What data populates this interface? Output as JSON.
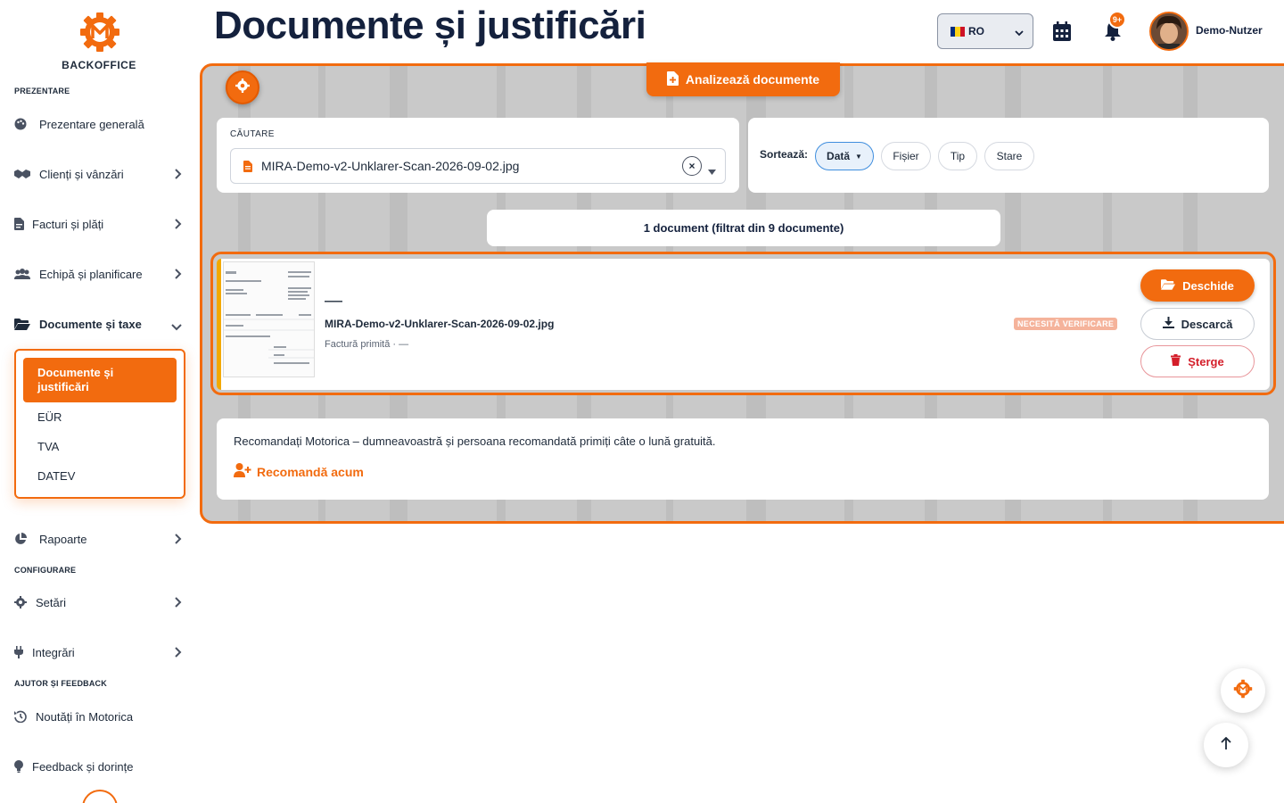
{
  "sidebar": {
    "logo_text": "BACKOFFICE",
    "sections": {
      "prezentare": "PREZENTARE",
      "configurare": "CONFIGURARE",
      "ajutor": "AJUTOR ȘI FEEDBACK"
    },
    "items": [
      {
        "label": "Prezentare generală",
        "icon": "palette-icon"
      },
      {
        "label": "Clienți și vânzări",
        "icon": "handshake-icon"
      },
      {
        "label": "Facturi și plăți",
        "icon": "invoice-icon"
      },
      {
        "label": "Echipă și planificare",
        "icon": "users-icon"
      },
      {
        "label": "Documente și taxe",
        "icon": "folder-open-icon"
      },
      {
        "label": "Rapoarte",
        "icon": "pie-chart-icon"
      },
      {
        "label": "Setări",
        "icon": "gear-icon"
      },
      {
        "label": "Integrări",
        "icon": "plug-icon"
      },
      {
        "label": "Noutăți în Motorica",
        "icon": "history-icon"
      },
      {
        "label": "Feedback și dorințe",
        "icon": "lightbulb-icon"
      }
    ],
    "submenu": {
      "active": "Documente și justificări",
      "items": [
        "EÜR",
        "TVA",
        "DATEV"
      ]
    }
  },
  "header": {
    "title": "Documente și justificări",
    "language": "RO",
    "notifications_badge": "9+",
    "username": "Demo-Nutzer"
  },
  "toolbar": {
    "analyze_label": "Analizează documente"
  },
  "search": {
    "label": "CĂUTARE",
    "value": "MIRA-Demo-v2-Unklarer-Scan-2026-09-02.jpg",
    "clear": "×"
  },
  "sort": {
    "label": "Sortează:",
    "options": [
      "Dată",
      "Fișier",
      "Tip",
      "Stare"
    ],
    "active_arrow": "▼"
  },
  "result_count": "1 document (filtrat din 9 documente)",
  "document": {
    "title": "—",
    "filename": "MIRA-Demo-v2-Unklarer-Scan-2026-09-02.jpg",
    "meta": "Factură primită · —",
    "status": "NECESITĂ VERIFICARE",
    "actions": {
      "open": "Deschide",
      "download": "Descarcă",
      "delete": "Șterge"
    }
  },
  "referral": {
    "text": "Recomandați Motorica – dumneavoastră și persoana recomandată primiți câte o lună gratuită.",
    "link": "Recomandă acum"
  },
  "colors": {
    "accent": "#f26b0f",
    "navy": "#14213d",
    "status_bg": "#f5b39b",
    "danger": "#d41e2a",
    "stripe": "#f2a900"
  }
}
